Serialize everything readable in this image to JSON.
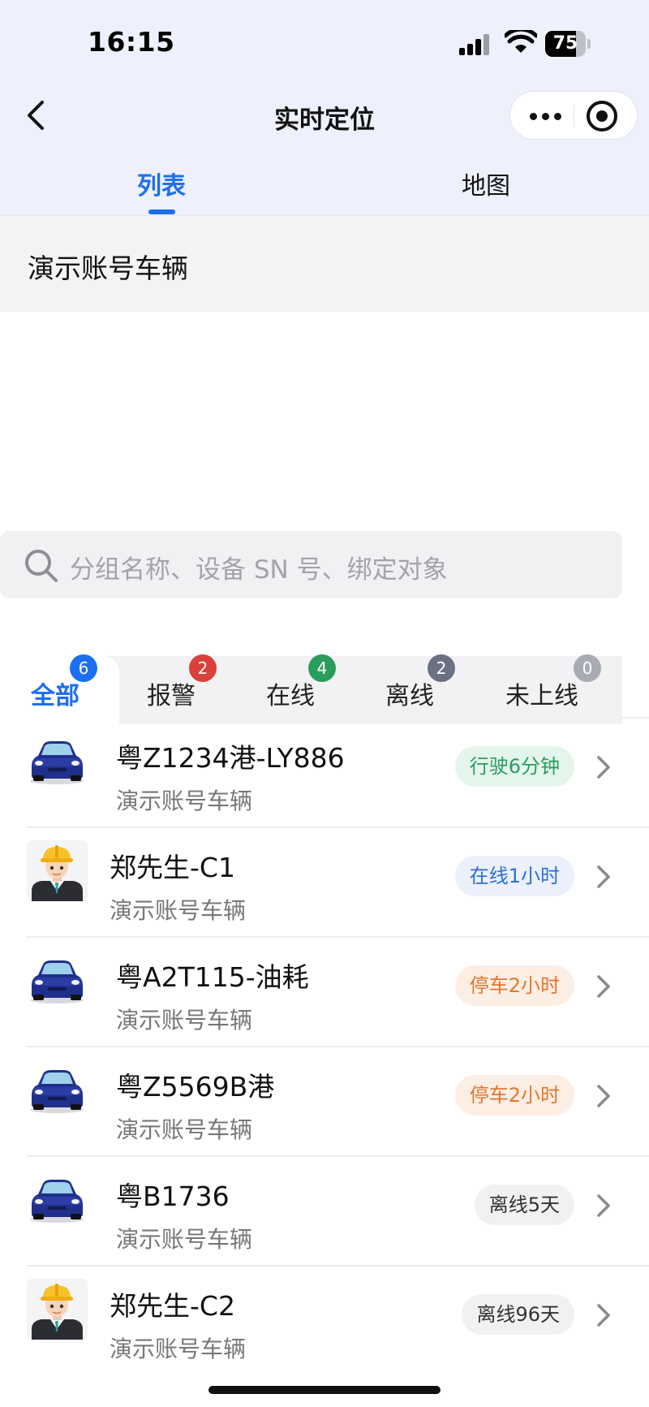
{
  "status_bar": {
    "time": "16:15",
    "battery": "75",
    "battery_level": 0.75
  },
  "nav": {
    "title": "实时定位"
  },
  "tabs": [
    {
      "label": "列表",
      "active": true
    },
    {
      "label": "地图",
      "active": false
    }
  ],
  "group": {
    "label": "演示账号车辆"
  },
  "search": {
    "placeholder": "分组名称、设备 SN 号、绑定对象"
  },
  "filters": [
    {
      "label": "全部",
      "count": "6",
      "badge_color": "#1d6ff0",
      "active": true
    },
    {
      "label": "报警",
      "count": "2",
      "badge_color": "#d9413a",
      "active": false
    },
    {
      "label": "在线",
      "count": "4",
      "badge_color": "#2a9d5c",
      "active": false
    },
    {
      "label": "离线",
      "count": "2",
      "badge_color": "#6b7183",
      "active": false
    },
    {
      "label": "未上线",
      "count": "0",
      "badge_color": "#a9abb4",
      "active": false
    }
  ],
  "vehicles": [
    {
      "name": "粤Z1234港-LY886",
      "group": "演示账号车辆",
      "status": "行驶6分钟",
      "status_type": "green",
      "avatar": "car-icon"
    },
    {
      "name": "郑先生-C1",
      "group": "演示账号车辆",
      "status": "在线1小时",
      "status_type": "blue",
      "avatar": "worker-icon"
    },
    {
      "name": "粤A2T115-油耗",
      "group": "演示账号车辆",
      "status": "停车2小时",
      "status_type": "orange",
      "avatar": "car-icon"
    },
    {
      "name": "粤Z5569B港",
      "group": "演示账号车辆",
      "status": "停车2小时",
      "status_type": "orange",
      "avatar": "car-icon"
    },
    {
      "name": "粤B1736",
      "group": "演示账号车辆",
      "status": "离线5天",
      "status_type": "gray",
      "avatar": "car-icon"
    },
    {
      "name": "郑先生-C2",
      "group": "演示账号车辆",
      "status": "离线96天",
      "status_type": "gray",
      "avatar": "worker-icon"
    }
  ]
}
